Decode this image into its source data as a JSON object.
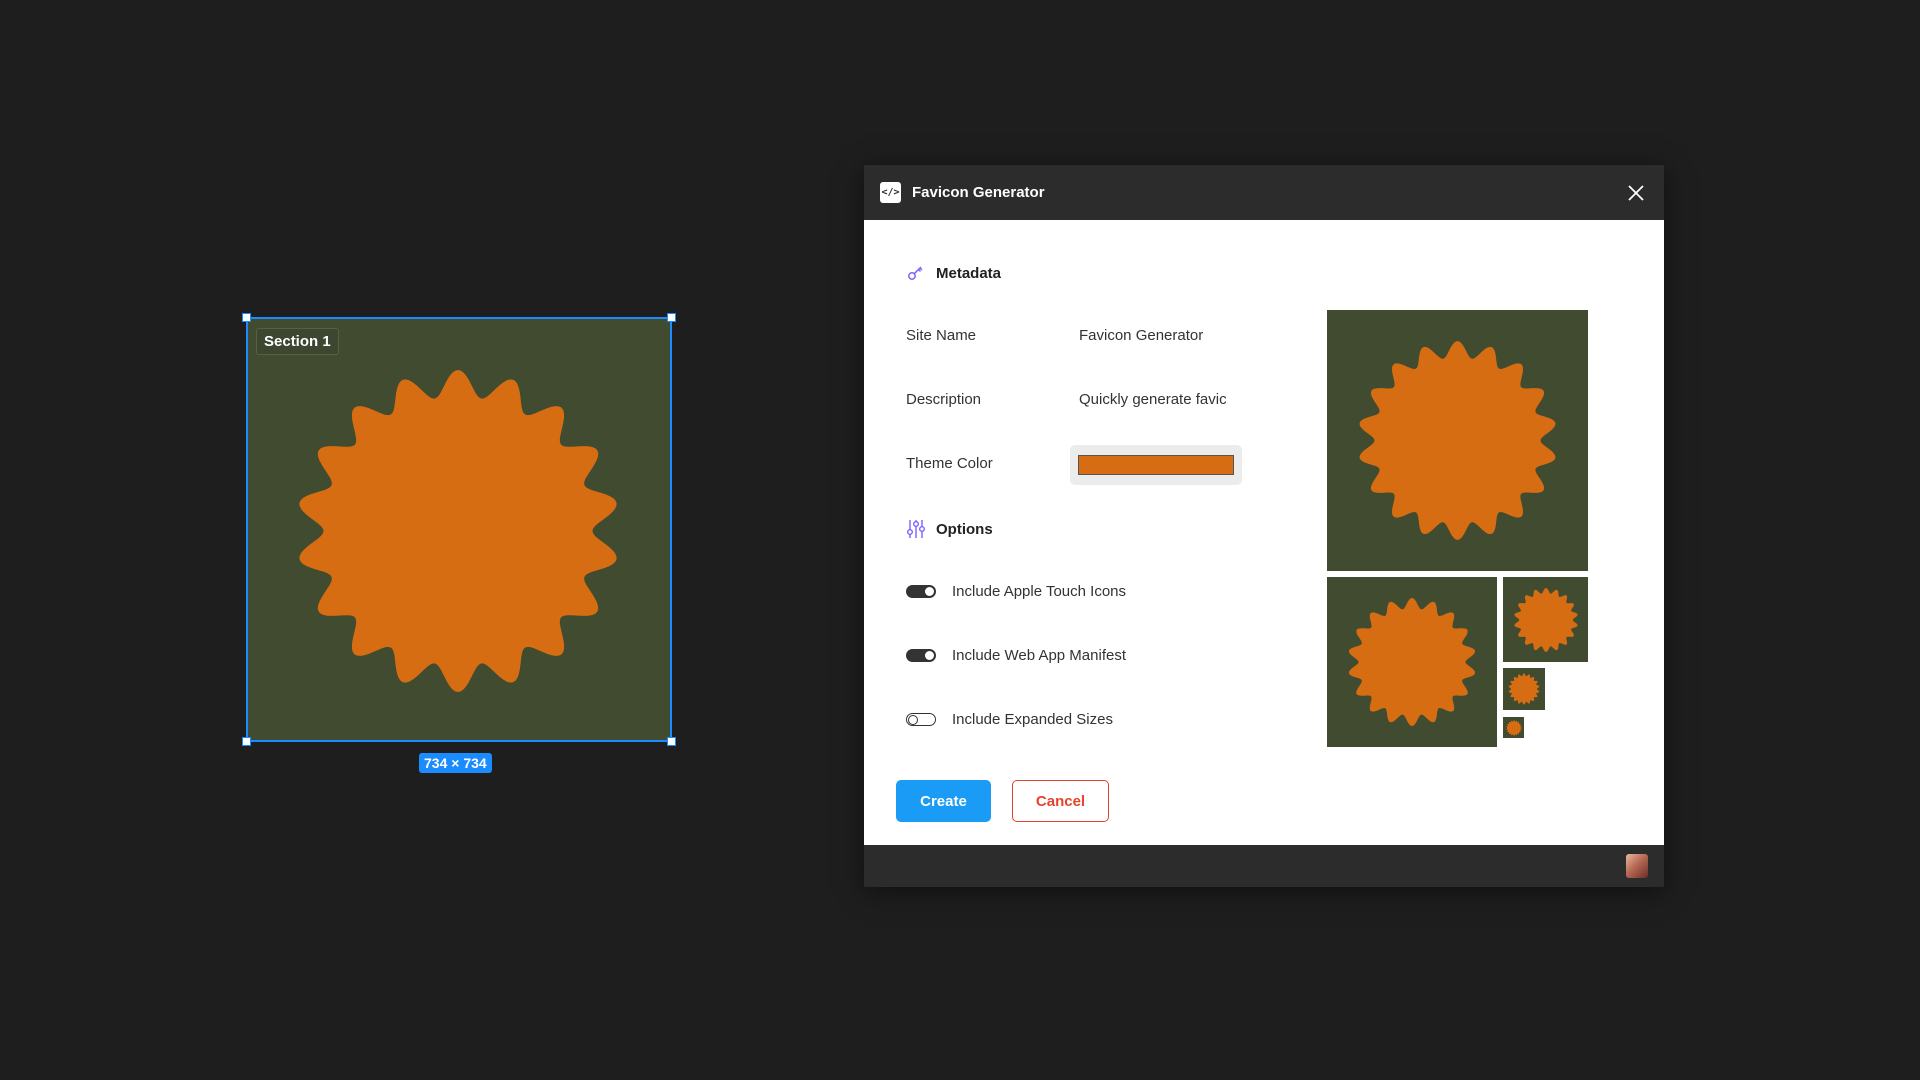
{
  "canvas": {
    "frame_label": "Section 1",
    "size_badge": "734 × 734",
    "frame_color": "#414b30",
    "selection_color": "#1a8cff"
  },
  "plugin": {
    "title": "Favicon Generator",
    "app_icon": "code-icon",
    "metadata": {
      "heading": "Metadata",
      "site_name_label": "Site Name",
      "site_name_value": "Favicon Generator",
      "description_label": "Description",
      "description_value": "Quickly generate favic",
      "theme_color_label": "Theme Color",
      "theme_color": "#d66d12"
    },
    "options": {
      "heading": "Options",
      "toggles": [
        {
          "label": "Include Apple Touch Icons",
          "state": "on"
        },
        {
          "label": "Include Web App Manifest",
          "state": "on"
        },
        {
          "label": "Include Expanded Sizes",
          "state": "off"
        }
      ]
    },
    "buttons": {
      "create": "Create",
      "cancel": "Cancel"
    }
  },
  "colors": {
    "shape": "#d66d12",
    "background": "#414b30",
    "accent": "#1a9bf5",
    "danger": "#e4432d"
  }
}
